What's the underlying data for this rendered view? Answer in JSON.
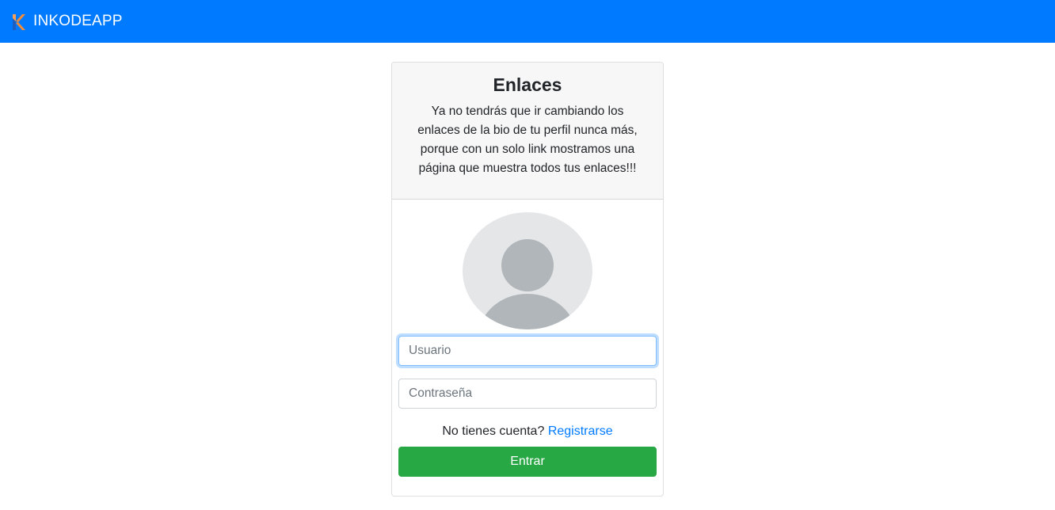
{
  "navbar": {
    "brand_name": "INKODEAPP",
    "brand_icon": "k-logo-icon",
    "background_color": "#007bff"
  },
  "card": {
    "title": "Enlaces",
    "description": "Ya no tendrás que ir cambiando los enlaces de la bio de tu perfil nunca más, porque con un solo link mostramos una página que muestra todos tus enlaces!!!"
  },
  "form": {
    "avatar_icon": "user-avatar-icon",
    "username_placeholder": "Usuario",
    "password_placeholder": "Contraseña",
    "no_account_text": "No tienes cuenta?",
    "register_link": "Registrarse",
    "submit_label": "Entrar",
    "submit_color": "#28a745",
    "link_color": "#007bff"
  }
}
